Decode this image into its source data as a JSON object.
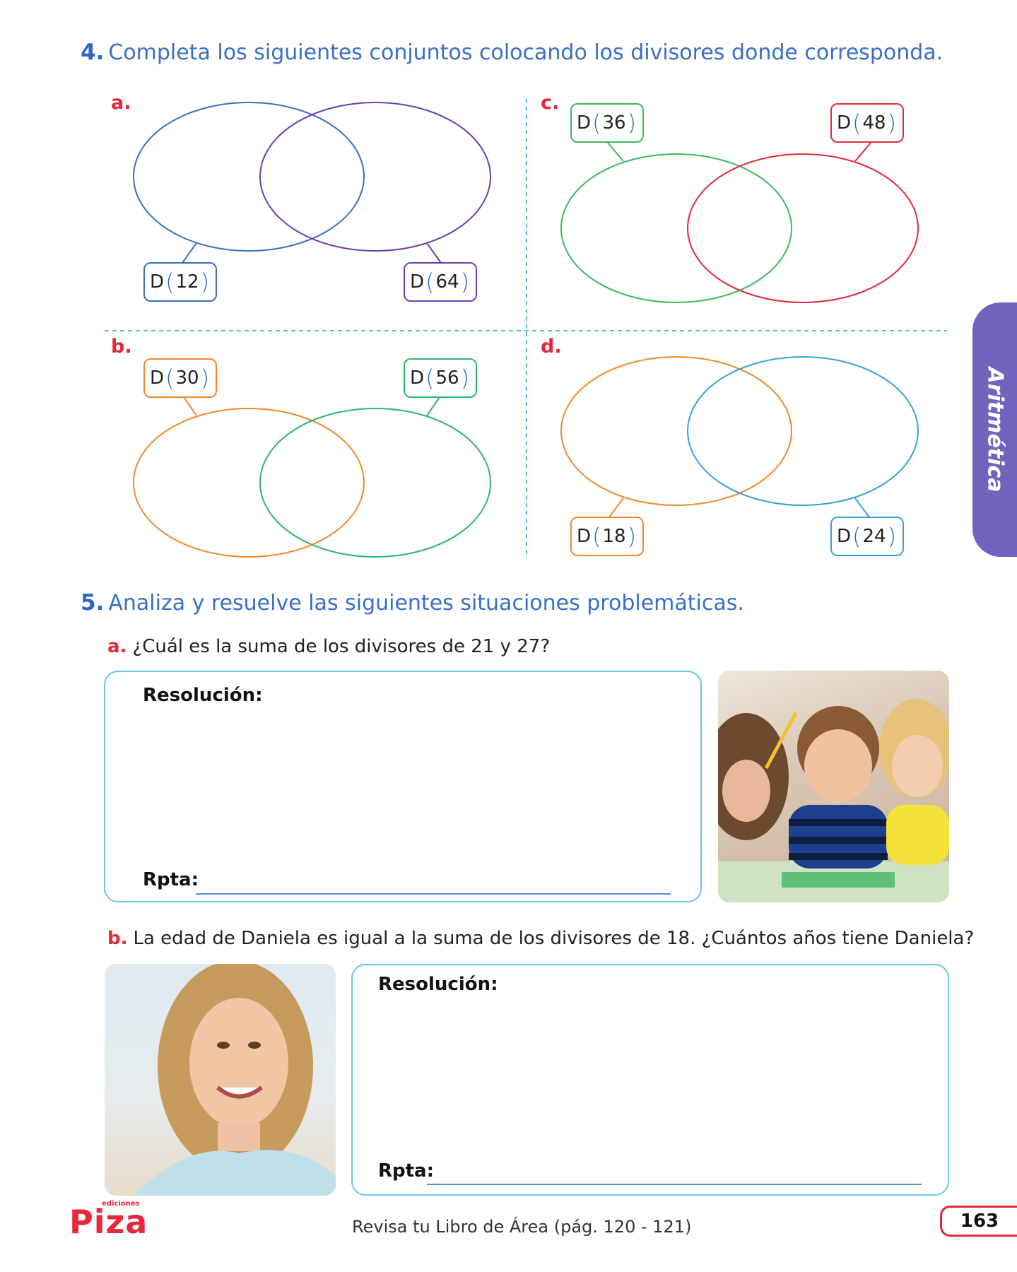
{
  "q4": {
    "number": "4.",
    "instruction": "Completa los siguientes conjuntos colocando los divisores donde corresponda.",
    "sections": [
      {
        "letter": "a.",
        "left_set": "12",
        "right_set": "64",
        "left_color": "#3a6fc4",
        "right_color": "#6a3fb5"
      },
      {
        "letter": "b.",
        "left_set": "30",
        "right_set": "56",
        "left_color": "#f08a2c",
        "right_color": "#2fb56a"
      },
      {
        "letter": "c.",
        "left_set": "36",
        "right_set": "48",
        "left_color": "#3cba5a",
        "right_color": "#e5283a"
      },
      {
        "letter": "d.",
        "left_set": "18",
        "right_set": "24",
        "left_color": "#f08a2c",
        "right_color": "#3aa0de"
      }
    ],
    "d_prefix": "D",
    "paren_open": "(",
    "paren_close": ")"
  },
  "q5": {
    "number": "5.",
    "instruction": "Analiza y resuelve las siguientes situaciones problemáticas.",
    "a": {
      "letter": "a.",
      "question": "¿Cuál es la suma de los divisores de 21 y 27?",
      "resolution_label": "Resolución:",
      "answer_label": "Rpta:"
    },
    "b": {
      "letter": "b.",
      "question": "La edad de Daniela es igual a la suma de los divisores de 18. ¿Cuántos años tiene Daniela?",
      "resolution_label": "Resolución:",
      "answer_label": "Rpta:"
    }
  },
  "side_tab": "Aritmética",
  "footer": {
    "logo_text": "Piza",
    "logo_small": "ediciones",
    "review_text": "Revisa tu Libro de Área (pág. 120 - 121)",
    "page_number": "163"
  },
  "colors": {
    "accent_blue": "#3a6fc4",
    "accent_red": "#e5283a",
    "tab_purple": "#7264bd",
    "box_border": "#6cc6e8"
  }
}
